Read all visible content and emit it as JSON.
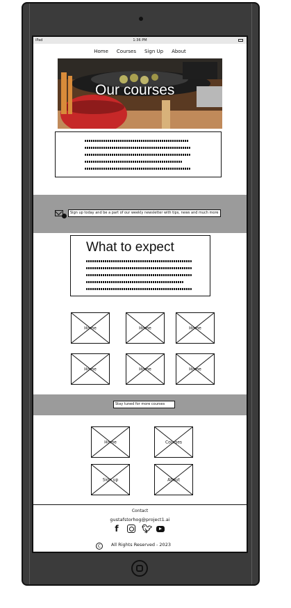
{
  "statusbar": {
    "device": "iPad",
    "time": "1:36 PM"
  },
  "nav": {
    "items": [
      "Home",
      "Courses",
      "Sign Up",
      "About"
    ]
  },
  "hero": {
    "title": "Our courses"
  },
  "newsletter": {
    "placeholder": "Sign up today and be a part of our weekly newsletter with tips, news and much more"
  },
  "expect": {
    "title": "What to expect"
  },
  "gallery": {
    "labels": [
      "Home",
      "Home",
      "Home",
      "Home",
      "Home",
      "Home"
    ]
  },
  "stay_tuned": {
    "placeholder": "Stay tuned for more courses"
  },
  "links": {
    "labels": [
      "Home",
      "Courses",
      "Sign up",
      "About"
    ]
  },
  "footer": {
    "contact": "Contact",
    "email": "gustafstorhog@project1.ai",
    "rights": "All Rights Reserved - 2023",
    "social_icons": [
      "facebook-icon",
      "instagram-icon",
      "twitter-icon",
      "youtube-icon"
    ]
  },
  "colors": {
    "device": "#3b3b3b",
    "band": "#9b9b9b",
    "grill": "#c62828"
  }
}
